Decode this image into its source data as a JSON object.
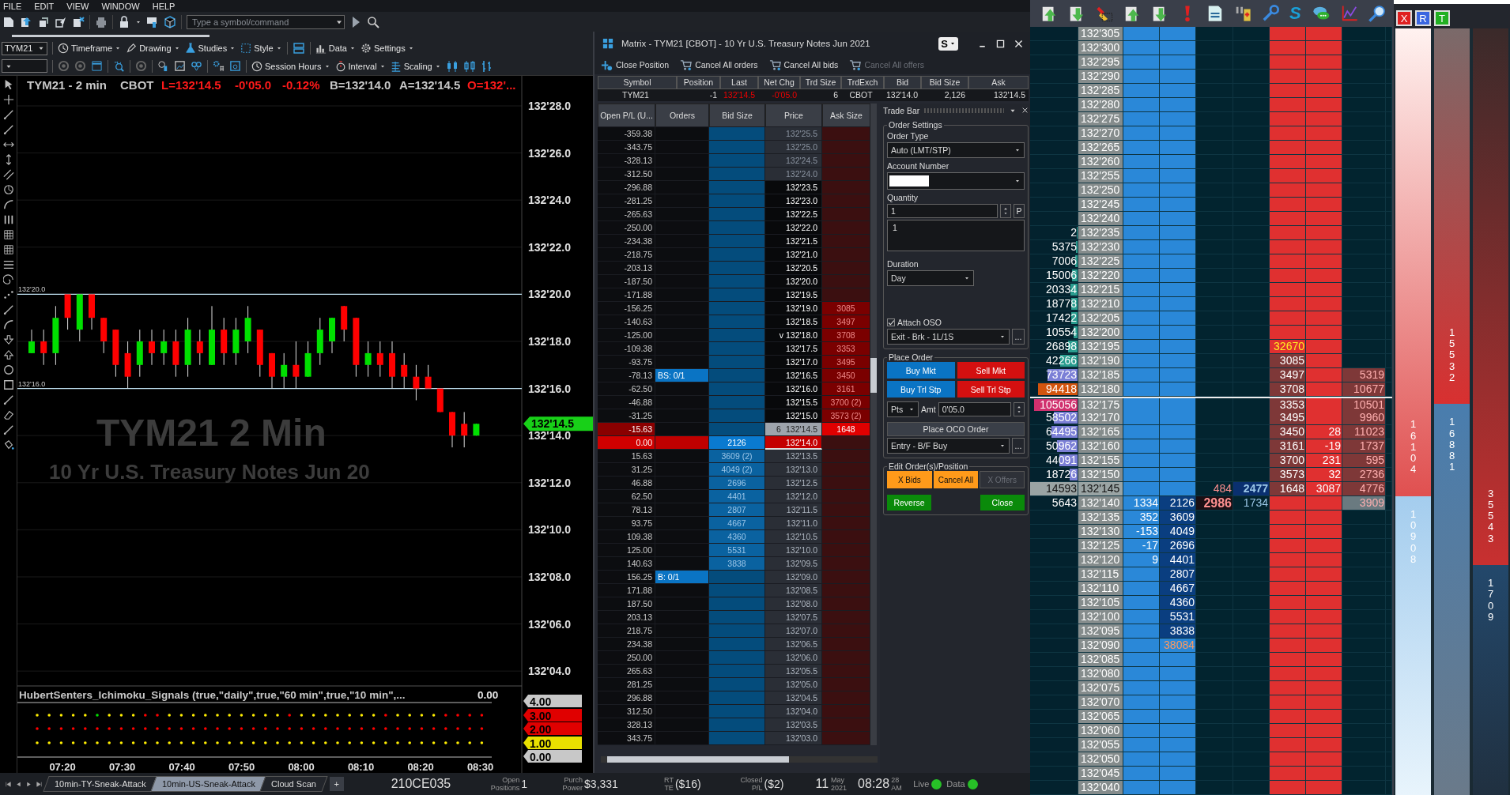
{
  "menu": [
    "FILE",
    "EDIT",
    "VIEW",
    "WINDOW",
    "HELP"
  ],
  "main_toolbar": {
    "placeholder": "Type a symbol/command"
  },
  "chart": {
    "symbol": "TYM21",
    "toolbar1": [
      "Timeframe",
      "Drawing",
      "Studies",
      "Style",
      "Data",
      "Settings"
    ],
    "toolbar2": [
      "Session Hours",
      "Interval",
      "Scaling"
    ],
    "header": [
      {
        "text": "TYM21 - 2 min",
        "kind": "plain"
      },
      {
        "text": "CBOT",
        "kind": "plain"
      },
      {
        "text": "L=132'14.5",
        "kind": "down"
      },
      {
        "text": "-0'05.0",
        "kind": "down"
      },
      {
        "text": "-0.12%",
        "kind": "down"
      },
      {
        "text": "B=132'14.0",
        "kind": "plain"
      },
      {
        "text": "A=132'14.5",
        "kind": "plain"
      },
      {
        "text": "O=132'...",
        "kind": "down"
      }
    ],
    "watermark": [
      "TYM21 2 Min",
      "10 Yr U.S. Treasury Notes Jun 20"
    ],
    "price_ticks": [
      "132'28.0",
      "132'26.0",
      "132'24.0",
      "132'22.0",
      "132'20.0",
      "132'18.0",
      "132'16.0",
      "132'14.0",
      "132'12.0",
      "132'10.0",
      "132'08.0",
      "132'06.0",
      "132'04.0"
    ],
    "lines": [
      "132'20.0",
      "132'16.0"
    ],
    "last_price": "132'14.5",
    "indicator": {
      "title": "HubertSenters_Ichimoku_Signals (true,\"daily\",true,\"60 min\",true,\"10 min\",...",
      "value": "0.00",
      "ticks": [
        {
          "label": "4.00",
          "color": "#c8c8c8"
        },
        {
          "label": "3.00",
          "color": "#e00000"
        },
        {
          "label": "2.00",
          "color": "#e00000"
        },
        {
          "label": "1.00",
          "color": "#e8e000"
        },
        {
          "label": "0.00",
          "color": "#c8c8c8"
        }
      ]
    },
    "time_ticks": [
      "07:20",
      "07:30",
      "07:40",
      "07:50",
      "08:00",
      "08:10",
      "08:20",
      "08:30"
    ]
  },
  "matrix": {
    "title": "Matrix - TYM21 [CBOT] - 10 Yr U.S. Treasury Notes Jun 2021",
    "layout_button": "S",
    "toolbar": [
      {
        "label": "Close Position",
        "disabled": false
      },
      {
        "label": "Cancel All orders",
        "disabled": false
      },
      {
        "label": "Cancel All bids",
        "disabled": false
      },
      {
        "label": "Cancel All offers",
        "disabled": true
      }
    ],
    "quote": {
      "columns": [
        "Symbol",
        "Position",
        "Last",
        "Net Chg",
        "Trd Size",
        "TrdExch",
        "Bid",
        "Bid Size",
        "Ask"
      ],
      "values": [
        "TYM21",
        "-1",
        "132'14.5",
        "-0'05.0",
        "6",
        "CBOT",
        "132'14.0",
        "2,126",
        "132'14.5"
      ]
    },
    "columns": [
      "Open P/L (U...",
      "Orders",
      "Bid Size",
      "Price",
      "Ask Size"
    ],
    "rows": [
      {
        "pl": "-359.38",
        "price": "132'25.5",
        "kind": "upper"
      },
      {
        "pl": "-343.75",
        "price": "132'25.0",
        "kind": "upper"
      },
      {
        "pl": "-328.13",
        "price": "132'24.5",
        "kind": "upper"
      },
      {
        "pl": "-312.50",
        "price": "132'24.0",
        "kind": "upper"
      },
      {
        "pl": "-296.88",
        "price": "132'23.5",
        "kind": "range"
      },
      {
        "pl": "-281.25",
        "price": "132'23.0",
        "kind": "range"
      },
      {
        "pl": "-265.63",
        "price": "132'22.5",
        "kind": "range"
      },
      {
        "pl": "-250.00",
        "price": "132'22.0",
        "kind": "range"
      },
      {
        "pl": "-234.38",
        "price": "132'21.5",
        "kind": "range"
      },
      {
        "pl": "-218.75",
        "price": "132'21.0",
        "kind": "range"
      },
      {
        "pl": "-203.13",
        "price": "132'20.5",
        "kind": "range"
      },
      {
        "pl": "-187.50",
        "price": "132'20.0",
        "kind": "range"
      },
      {
        "pl": "-171.88",
        "price": "132'19.5",
        "kind": "range"
      },
      {
        "pl": "-156.25",
        "price": "132'19.0",
        "ask": "3085",
        "kind": "range"
      },
      {
        "pl": "-140.63",
        "price": "132'18.5",
        "ask": "3497",
        "kind": "range"
      },
      {
        "pl": "-125.00",
        "price": "v 132'18.0",
        "ask": "3708",
        "kind": "range"
      },
      {
        "pl": "-109.38",
        "price": "132'17.5",
        "ask": "3353",
        "kind": "range"
      },
      {
        "pl": "-93.75",
        "price": "132'17.0",
        "ask": "3495",
        "kind": "range"
      },
      {
        "pl": "-78.13",
        "orders": "BS: 0/1",
        "price": "132'16.5",
        "ask": "3450",
        "kind": "range"
      },
      {
        "pl": "-62.50",
        "price": "132'16.0",
        "ask": "3161",
        "kind": "range"
      },
      {
        "pl": "-46.88",
        "price": "132'15.5",
        "ask": "3700  (2)",
        "kind": "range"
      },
      {
        "pl": "-31.25",
        "price": "132'15.0",
        "ask": "3573  (2)",
        "kind": "range"
      },
      {
        "pl": "-15.63",
        "trade": "6",
        "price": "132'14.5",
        "ask": "1648",
        "kind": "last"
      },
      {
        "pl": "0.00",
        "bid": "2126",
        "price": "132'14.0",
        "kind": "best_bid"
      },
      {
        "pl": "15.63",
        "bid": "3609  (2)",
        "price": "132'13.5",
        "kind": "lower"
      },
      {
        "pl": "31.25",
        "bid": "4049  (2)",
        "price": "132'13.0",
        "kind": "lower"
      },
      {
        "pl": "46.88",
        "bid": "2696",
        "price": "132'12.5",
        "kind": "lower"
      },
      {
        "pl": "62.50",
        "bid": "4401",
        "price": "132'12.0",
        "kind": "lower"
      },
      {
        "pl": "78.13",
        "bid": "2807",
        "price": "132'11.5",
        "kind": "lower"
      },
      {
        "pl": "93.75",
        "bid": "4667",
        "price": "132'11.0",
        "kind": "lower"
      },
      {
        "pl": "109.38",
        "bid": "4360",
        "price": "132'10.5",
        "kind": "lower"
      },
      {
        "pl": "125.00",
        "bid": "5531",
        "price": "132'10.0",
        "kind": "lower"
      },
      {
        "pl": "140.63",
        "bid": "3838",
        "price": "132'09.5",
        "kind": "lower"
      },
      {
        "pl": "156.25",
        "orders": "B: 0/1",
        "price": "132'09.0",
        "kind": "lower"
      },
      {
        "pl": "171.88",
        "price": "132'08.5",
        "kind": "lower"
      },
      {
        "pl": "187.50",
        "price": "132'08.0",
        "kind": "lower"
      },
      {
        "pl": "203.13",
        "price": "132'07.5",
        "kind": "lower"
      },
      {
        "pl": "218.75",
        "price": "132'07.0",
        "kind": "lower"
      },
      {
        "pl": "234.38",
        "price": "132'06.5",
        "kind": "lower"
      },
      {
        "pl": "250.00",
        "price": "132'06.0",
        "kind": "lower"
      },
      {
        "pl": "265.63",
        "price": "132'05.5",
        "kind": "lower"
      },
      {
        "pl": "281.25",
        "price": "132'05.0",
        "kind": "lower"
      },
      {
        "pl": "296.88",
        "price": "132'04.5",
        "kind": "lower"
      },
      {
        "pl": "312.50",
        "price": "132'04.0",
        "kind": "lower"
      },
      {
        "pl": "328.13",
        "price": "132'03.5",
        "kind": "lower"
      },
      {
        "pl": "343.75",
        "price": "132'03.0",
        "kind": "lower"
      }
    ],
    "trade_bar": {
      "title": "Trade Bar",
      "order_settings": "Order Settings",
      "order_type_label": "Order Type",
      "order_type": "Auto (LMT/STP)",
      "account_label": "Account Number",
      "quantity_label": "Quantity",
      "quantity": "1",
      "p_button": "P",
      "memo": "1",
      "duration_label": "Duration",
      "duration": "Day",
      "attach_oso": {
        "label": "Attach OSO",
        "checked": true
      },
      "oso_strategy": "Exit - Brk - 1L/1S",
      "oso_more": "...",
      "place_order": "Place Order",
      "order_buttons": [
        {
          "label": "Buy Mkt",
          "kind": "buy"
        },
        {
          "label": "Sell Mkt",
          "kind": "sell"
        },
        {
          "label": "Buy Trl Stp",
          "kind": "buy"
        },
        {
          "label": "Sell Trl Stp",
          "kind": "sell"
        }
      ],
      "trail_unit": "Pts",
      "amt_label": "Amt",
      "amt": "0'05.0",
      "oco_button": "Place OCO Order",
      "entry_strategy": "Entry - B/F Buy",
      "entry_more": "...",
      "edit_group": "Edit Order(s)/Position",
      "edit_buttons": [
        {
          "label": "X Bids",
          "disabled": false
        },
        {
          "label": "Cancel All",
          "disabled": false
        },
        {
          "label": "X Offers",
          "disabled": true
        }
      ],
      "final_buttons": [
        "Reverse",
        "Close"
      ]
    }
  },
  "status_bar": {
    "tabs": [
      {
        "label": "10min-TY-Sneak-Attack",
        "selected": false
      },
      {
        "label": "10min-US-Sneak-Attack",
        "selected": true
      },
      {
        "label": "Cloud Scan",
        "selected": false
      }
    ],
    "add": "+",
    "account": "210CE035",
    "stats": [
      {
        "label": "Open Positions",
        "value": "1"
      },
      {
        "label": "Purch Power",
        "value": "$3,331"
      },
      {
        "label": "RT TE",
        "value": "($16)"
      },
      {
        "label": "Closed P/L",
        "value": "($2)"
      }
    ],
    "day": "11",
    "month_year": "May 2021",
    "time": "08:28",
    "seconds_ampm": "28 AM",
    "connections": [
      {
        "label": "Live",
        "on": true
      },
      {
        "label": "Data",
        "on": true
      }
    ]
  },
  "ladder": {
    "logo_letter": "S",
    "buttons": [
      {
        "label": "X",
        "color": "#e02020"
      },
      {
        "label": "R",
        "color": "#3a66e0"
      },
      {
        "label": "T",
        "color": "#22b022"
      }
    ],
    "rows": [
      {
        "price": "132'305"
      },
      {
        "price": "132'300"
      },
      {
        "price": "132'295"
      },
      {
        "price": "132'290"
      },
      {
        "price": "132'285"
      },
      {
        "price": "132'280"
      },
      {
        "price": "132'275"
      },
      {
        "price": "132'270"
      },
      {
        "price": "132'265"
      },
      {
        "price": "132'260"
      },
      {
        "price": "132'255"
      },
      {
        "price": "132'250"
      },
      {
        "price": "132'245"
      },
      {
        "price": "132'240"
      },
      {
        "column_1": "2",
        "level": 0.02,
        "color": "#2a9d8f",
        "price": "132'235"
      },
      {
        "column_1": "5375",
        "level": 0.04,
        "color": "#2a9d8f",
        "price": "132'230"
      },
      {
        "column_1": "7006",
        "level": 0.05,
        "color": "#2a9d8f",
        "price": "132'225"
      },
      {
        "column_1": "15006",
        "level": 0.11,
        "color": "#2a9d8f",
        "price": "132'220"
      },
      {
        "column_1": "20334",
        "level": 0.15,
        "color": "#2a9d8f",
        "price": "132'215"
      },
      {
        "column_1": "18778",
        "level": 0.14,
        "color": "#2a9d8f",
        "price": "132'210"
      },
      {
        "column_1": "17422",
        "level": 0.13,
        "color": "#2a9d8f",
        "price": "132'205"
      },
      {
        "column_1": "10554",
        "level": 0.08,
        "color": "#2a9d8f",
        "price": "132'200"
      },
      {
        "column_1": "26898",
        "level": 0.2,
        "color": "#2a9d8f",
        "price": "132'195",
        "column_7": "32670",
        "alert": true
      },
      {
        "column_1": "42266",
        "level": 0.36,
        "color": "#2a9d8f",
        "price": "132'190",
        "column_7": "3085"
      },
      {
        "column_1": "73723",
        "level": 0.63,
        "color": "#7b7fd6",
        "price": "132'185",
        "column_7": "3497",
        "column_9": "5319"
      },
      {
        "column_1": "94418",
        "level": 0.83,
        "color": "#d2540e",
        "price": "132'180",
        "column_7": "3708",
        "column_9": "10677"
      },
      {
        "column_1": "105056",
        "level": 0.92,
        "color": "#d0306e",
        "price": "132'175",
        "column_7": "3353",
        "column_9": "10501",
        "marker": true
      },
      {
        "column_1": "58502",
        "level": 0.5,
        "color": "#7b7fd6",
        "price": "132'170",
        "column_7": "3495",
        "column_9": "9960"
      },
      {
        "column_1": "64495",
        "level": 0.55,
        "color": "#7b7fd6",
        "price": "132'165",
        "column_7": "3450",
        "column_8": "28",
        "column_9": "11023"
      },
      {
        "column_1": "50962",
        "level": 0.44,
        "color": "#7b7fd6",
        "price": "132'160",
        "column_7": "3161",
        "column_8": "-19",
        "column_9": "1737"
      },
      {
        "column_1": "44091",
        "level": 0.38,
        "color": "#7b7fd6",
        "price": "132'155",
        "column_7": "3700",
        "column_8": "231",
        "column_9": "595"
      },
      {
        "column_1": "18726",
        "level": 0.16,
        "color": "#7b7fd6",
        "price": "132'150",
        "column_7": "3573",
        "column_8": "32",
        "column_9": "2736"
      },
      {
        "column_1": "14593",
        "price": "132'145",
        "column_5": "484",
        "column_6": "2477",
        "column_7": "1648",
        "column_8": "3087",
        "column_9": "4776",
        "kind": "last_trade"
      },
      {
        "column_1": "5643",
        "price": "132'140",
        "column_3": "1334",
        "column_4": "2126",
        "column_5": "2986",
        "column_6": "1734",
        "column_9": "3909",
        "kind": "inside"
      },
      {
        "price": "132'135",
        "column_3": "352",
        "column_4": "3609"
      },
      {
        "price": "132'130",
        "column_3": "-153",
        "column_4": "4049"
      },
      {
        "price": "132'125",
        "column_3": "-17",
        "column_4": "2696"
      },
      {
        "price": "132'120",
        "column_3": "9",
        "column_4": "4401"
      },
      {
        "price": "132'115",
        "column_4": "2807"
      },
      {
        "price": "132'110",
        "column_4": "4667"
      },
      {
        "price": "132'105",
        "column_4": "4360"
      },
      {
        "price": "132'100",
        "column_4": "5531"
      },
      {
        "price": "132'095",
        "column_4": "3838"
      },
      {
        "price": "132'090",
        "column_4": "38084",
        "alert": true
      },
      {
        "price": "132'085"
      },
      {
        "price": "132'080"
      },
      {
        "price": "132'075"
      },
      {
        "price": "132'070"
      },
      {
        "price": "132'065"
      },
      {
        "price": "132'060"
      },
      {
        "price": "132'055"
      },
      {
        "price": "132'050"
      },
      {
        "price": "132'045"
      },
      {
        "price": "132'040"
      }
    ],
    "meters": [
      {
        "level": 0.61,
        "ask": "16104",
        "bid": "10908"
      },
      {
        "level": 0.49,
        "ask": "15532",
        "bid": "16881"
      },
      {
        "level": 0.7,
        "ask": "35543",
        "bid": "1709"
      }
    ]
  }
}
